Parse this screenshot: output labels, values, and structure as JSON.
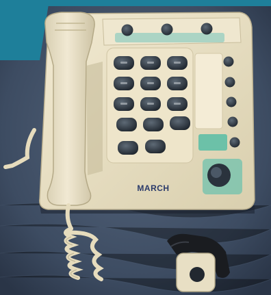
{
  "photo": {
    "subject_icons": [
      "desk-phone-icon",
      "handset-icon",
      "coiled-cord-icon",
      "wrist-pendant-icon"
    ],
    "brand_label": "MARCH",
    "colors": {
      "frame_teal": "#1e7f9a",
      "fabric_blue": "#3f5068",
      "phone_beige": "#e8dfc4",
      "key_dark": "#2d3640",
      "strap_black": "#1a1c20"
    }
  }
}
